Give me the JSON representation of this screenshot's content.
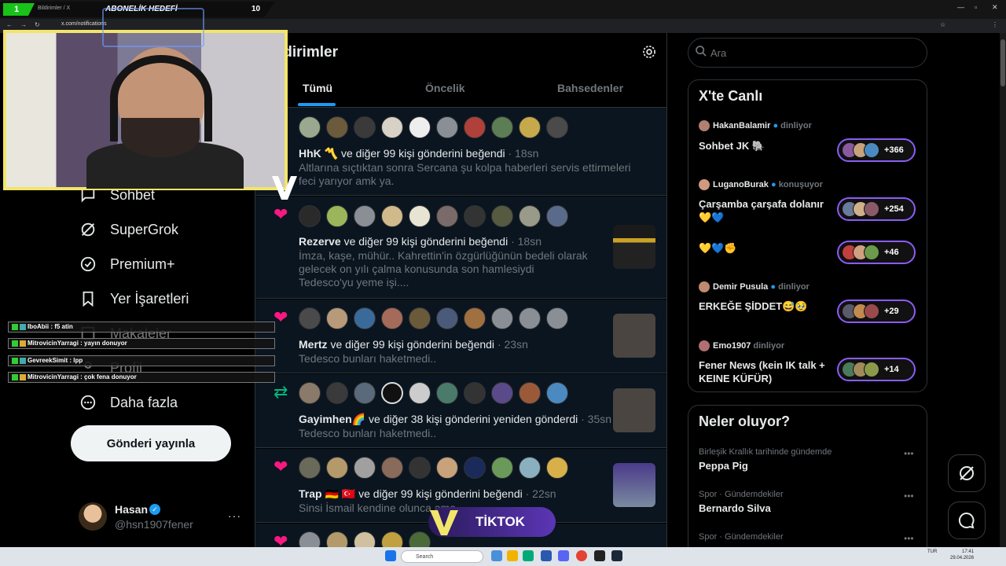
{
  "overlay": {
    "goal_rank": "1",
    "goal_label": "ABONELİK HEDEFİ",
    "goal_target": "10",
    "tiktok": "TİKTOK",
    "chat": [
      {
        "text": "IboAbii : f5 atin"
      },
      {
        "text": "MitrovicinYarragi : yayın donuyor"
      },
      {
        "text": "GevreekSimit : lpp"
      },
      {
        "text": "MitrovicinYarragi : çok fena donuyor"
      }
    ]
  },
  "browser": {
    "tab_title": "Bildirimler / X",
    "url": "x.com/notifications"
  },
  "nav": {
    "items": [
      {
        "label": "Sohbet",
        "icon": "chat-bubble-icon"
      },
      {
        "label": "SuperGrok",
        "icon": "grok-icon"
      },
      {
        "label": "Premium+",
        "icon": "verified-badge-icon"
      },
      {
        "label": "Yer İşaretleri",
        "icon": "bookmark-icon"
      },
      {
        "label": "Makaleler",
        "icon": "article-icon"
      },
      {
        "label": "Profil",
        "icon": "profile-icon"
      },
      {
        "label": "Daha fazla",
        "icon": "more-circle-icon"
      }
    ],
    "post_button": "Gönderi yayınla",
    "account": {
      "name": "Hasan",
      "handle": "@hsn1907fener",
      "more": "···"
    }
  },
  "main": {
    "title": "ldirimler",
    "tabs": [
      {
        "label": "Tümü",
        "active": true
      },
      {
        "label": "Öncelik",
        "active": false
      },
      {
        "label": "Bahsedenler",
        "active": false
      }
    ],
    "notifications": [
      {
        "type": "like",
        "user": "HhK",
        "emoji": "〽️",
        "action": "ve diğer 99 kişi gönderini beğendi",
        "time": "18sn",
        "text": "Altlarına sıçtıktan sonra Sercana şu kolpa haberleri servis ettirmeleri feci yarıyor amk ya."
      },
      {
        "type": "like",
        "user": "Rezerve",
        "emoji": "",
        "action": "ve diğer 99 kişi gönderini beğendi",
        "time": "18sn",
        "text": "İmza, kaşe, mühür.. Kahrettin'in özgürlüğünün bedeli olarak gelecek on yılı çalma konusunda son hamlesiydi Tedesco'yu yeme işi...."
      },
      {
        "type": "like",
        "user": "Mertz",
        "emoji": "",
        "action": "ve diğer 99 kişi gönderini beğendi",
        "time": "23sn",
        "text": "Tedesco bunları haketmedi.."
      },
      {
        "type": "repost",
        "user": "Gayimhen",
        "emoji": "🌈",
        "action": "ve diğer 38 kişi gönderini yeniden gönderdi",
        "time": "35sn",
        "text": "Tedesco bunları haketmedi.."
      },
      {
        "type": "like",
        "user": "Trap",
        "emoji": "🇩🇪 🇹🇷",
        "action": "ve diğer 99 kişi gönderini beğendi",
        "time": "22sn",
        "text": "Sinsi İsmail kendine olunca                                  ama.."
      }
    ]
  },
  "search": {
    "placeholder": "Ara"
  },
  "live": {
    "title": "X'te Canlı",
    "spaces": [
      {
        "host": "HakanBalamir",
        "role": "dinliyor",
        "title": "Sohbet JK 🐘",
        "count": "+366"
      },
      {
        "host": "LuganoBurak",
        "role": "konuşuyor",
        "title": "Çarşamba çarşafa dolanır💛💙",
        "count": "+254"
      },
      {
        "host": "",
        "role": "",
        "title": "💛💙✊",
        "count": "+46"
      },
      {
        "host": "Demir Pusula",
        "role": "dinliyor",
        "title": "ERKEĞE ŞİDDET😅🥹",
        "count": "+29"
      },
      {
        "host": "Emo1907",
        "role": "dinliyor",
        "title": "Fener News (kein IK talk + KEINE KÜFÜR)",
        "count": "+14"
      }
    ]
  },
  "trends": {
    "title": "Neler oluyor?",
    "items": [
      {
        "meta": "Birleşik Krallık tarihinde gündemde",
        "name": "Peppa Pig"
      },
      {
        "meta": "Spor · Gündemdekiler",
        "name": "Bernardo Silva"
      },
      {
        "meta": "Spor · Gündemdekiler",
        "name": ""
      }
    ]
  },
  "taskbar": {
    "search": "Search",
    "lang": "TUR",
    "time": "17:41",
    "date": "29.04.2026"
  },
  "colors": {
    "accent": "#1d9bf0",
    "like": "#f91880",
    "repost": "#00ba7c",
    "space_pill": "#8b5cf6",
    "cam_border": "#f2e56b"
  }
}
